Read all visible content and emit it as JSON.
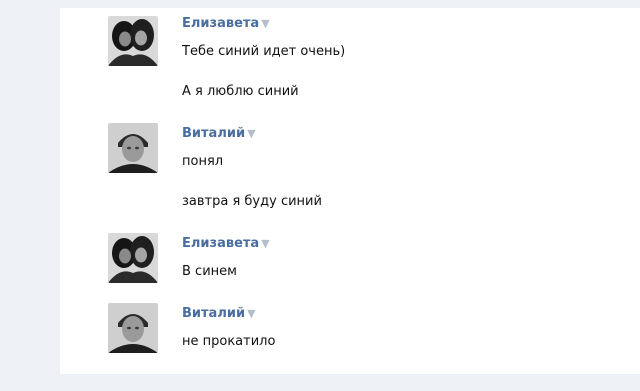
{
  "messages": [
    {
      "author": "Елизавета",
      "avatar": "avatar-two-girls",
      "lines": [
        "Тебе синий идет очень)",
        "А я люблю синий"
      ]
    },
    {
      "author": "Виталий",
      "avatar": "avatar-boy",
      "lines": [
        "понял",
        "завтра я буду синий"
      ]
    },
    {
      "author": "Елизавета",
      "avatar": "avatar-two-girls",
      "lines": [
        "В синем"
      ]
    },
    {
      "author": "Виталий",
      "avatar": "avatar-boy",
      "lines": [
        "не прокатило"
      ]
    }
  ],
  "ui": {
    "caret_glyph": "▼",
    "author_color": "#4a6ea0",
    "caret_color": "#b5bfca",
    "page_background": "#edf1f5"
  }
}
